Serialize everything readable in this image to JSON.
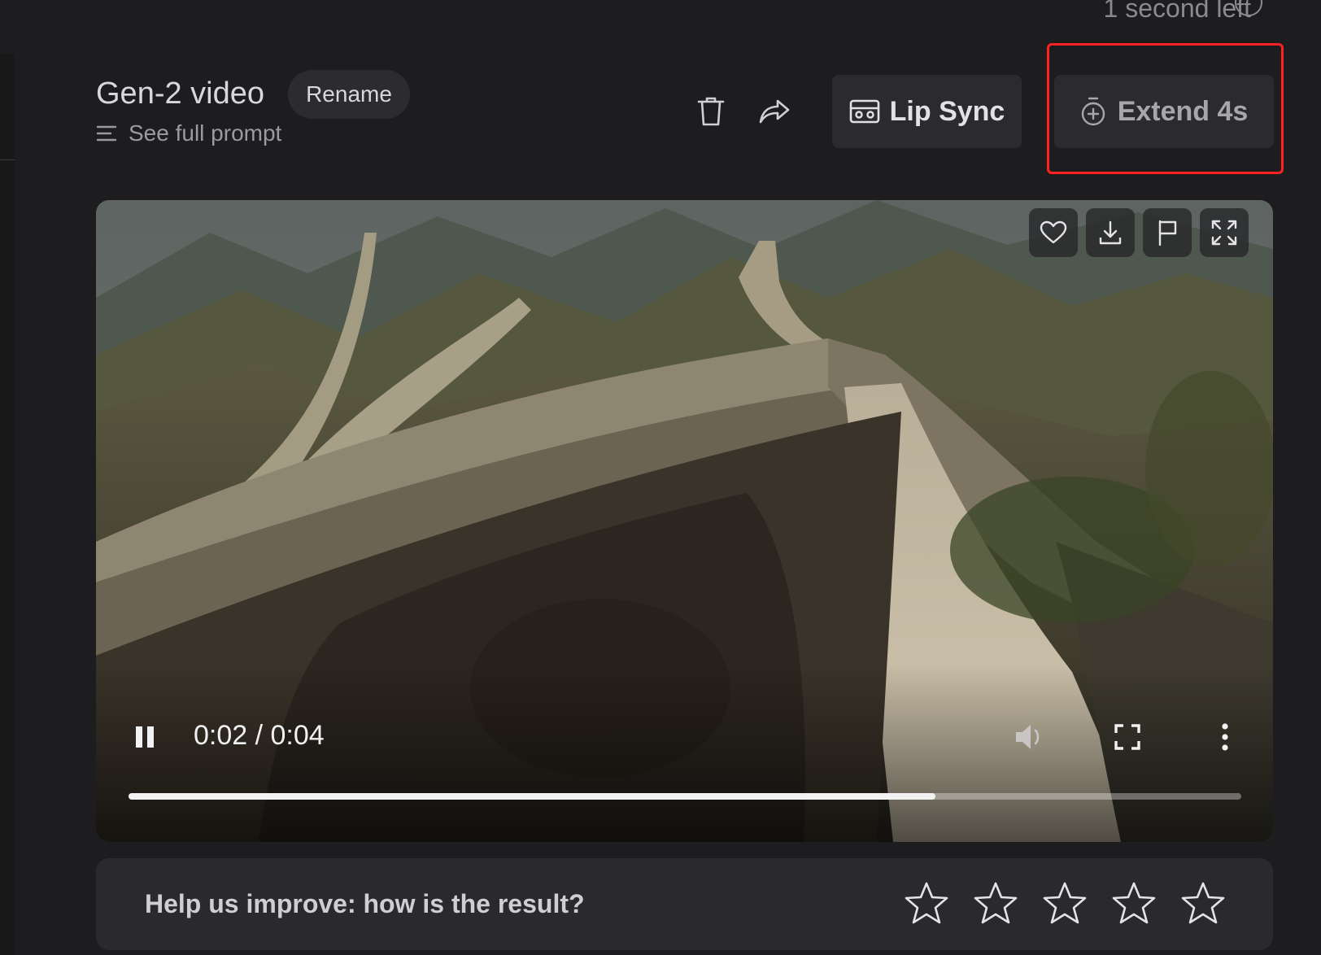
{
  "header": {
    "time_left": "1 second left",
    "title": "Gen-2 video",
    "rename_label": "Rename",
    "see_prompt_label": "See full prompt"
  },
  "toolbar": {
    "delete_icon": "trash-icon",
    "share_icon": "share-arrow-icon",
    "lip_sync_label": "Lip Sync",
    "extend_label": "Extend 4s"
  },
  "video": {
    "actions": [
      "heart-icon",
      "download-icon",
      "flag-icon",
      "expand-icon"
    ],
    "time_display": "0:02 / 0:04",
    "progress": 0.725
  },
  "feedback": {
    "question": "Help us improve: how is the result?",
    "stars": 5
  },
  "colors": {
    "background": "#1d1d1f",
    "button": "#2b2b2e",
    "highlight": "#ff2222"
  }
}
